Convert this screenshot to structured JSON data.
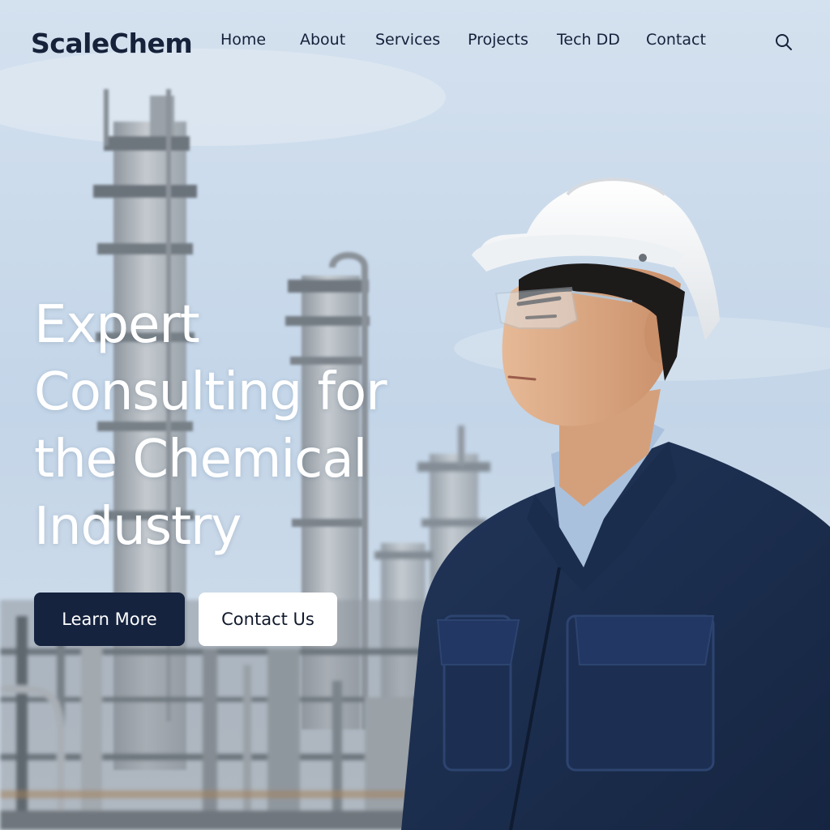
{
  "brand": {
    "name": "ScaleChem"
  },
  "nav": {
    "items": [
      {
        "label": "Home"
      },
      {
        "label": "About"
      },
      {
        "label": "Services"
      },
      {
        "label": "Projects"
      },
      {
        "label": "Tech DD"
      },
      {
        "label": "Contact"
      }
    ],
    "search_icon": "search-icon"
  },
  "hero": {
    "headline": "Expert Consulting for the Chemical Industry",
    "primary_button": "Learn More",
    "secondary_button": "Contact Us"
  },
  "colors": {
    "brand_navy": "#15233f",
    "text_dark": "#16223a",
    "sky": "#c9d9ea",
    "white": "#ffffff"
  }
}
